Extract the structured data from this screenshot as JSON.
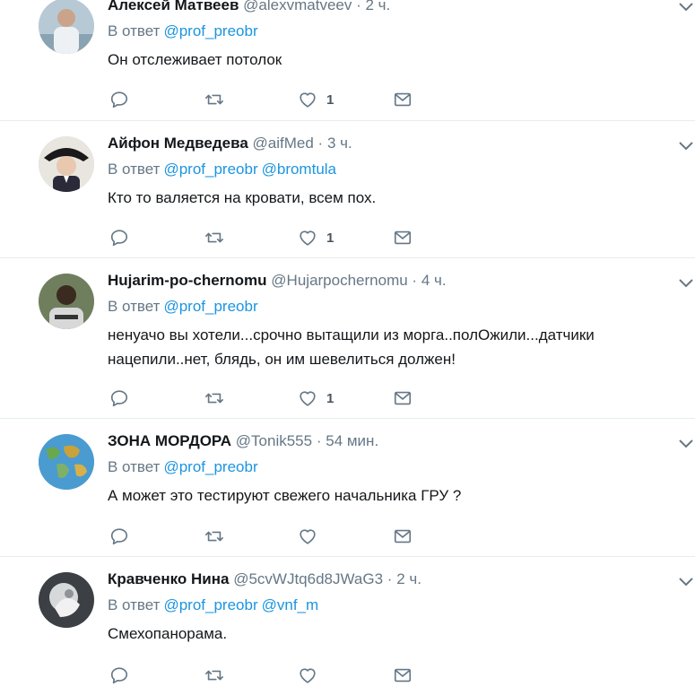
{
  "colors": {
    "link": "#1b95e0",
    "secondary": "#657786",
    "divider": "#e6ecf0"
  },
  "icons": {
    "reply": "reply-icon",
    "retweet": "retweet-icon",
    "like": "heart-icon",
    "dm": "envelope-icon",
    "menu": "chevron-down-icon"
  },
  "tweets": [
    {
      "name": "Алексей Матвеев",
      "handle": "@alexvmatveev",
      "dot": "·",
      "time": "2 ч.",
      "reply_prefix": "В ответ",
      "mentions": [
        "@prof_preobr"
      ],
      "text": "Он отслеживает потолок",
      "likes": "1"
    },
    {
      "name": "Айфон Медведева",
      "handle": "@aifMed",
      "dot": "·",
      "time": "3 ч.",
      "reply_prefix": "В ответ",
      "mentions": [
        "@prof_preobr",
        "@bromtula"
      ],
      "text": "Кто то валяется на кровати, всем пох.",
      "likes": "1"
    },
    {
      "name": "Hujarim-po-chernomu",
      "handle": "@Hujarpochernomu",
      "dot": "·",
      "time": "4 ч.",
      "reply_prefix": "В ответ",
      "mentions": [
        "@prof_preobr"
      ],
      "text": "ненуачо вы хотели...срочно вытащили из морга..полОжили...датчики нацепили..нет, блядь, он им шевелиться должен!",
      "likes": "1"
    },
    {
      "name": "ЗОНА МОРДОРА",
      "handle": "@Tonik555",
      "dot": "·",
      "time": "54 мин.",
      "reply_prefix": "В ответ",
      "mentions": [
        "@prof_preobr"
      ],
      "text": "А может это тестируют свежего начальника ГРУ ?",
      "likes": ""
    },
    {
      "name": "Кравченко Нина",
      "handle": "@5cvWJtq6d8JWaG3",
      "dot": "·",
      "time": "2 ч.",
      "reply_prefix": "В ответ",
      "mentions": [
        "@prof_preobr",
        "@vnf_m"
      ],
      "text": "Смехопанорама.",
      "likes": ""
    }
  ]
}
